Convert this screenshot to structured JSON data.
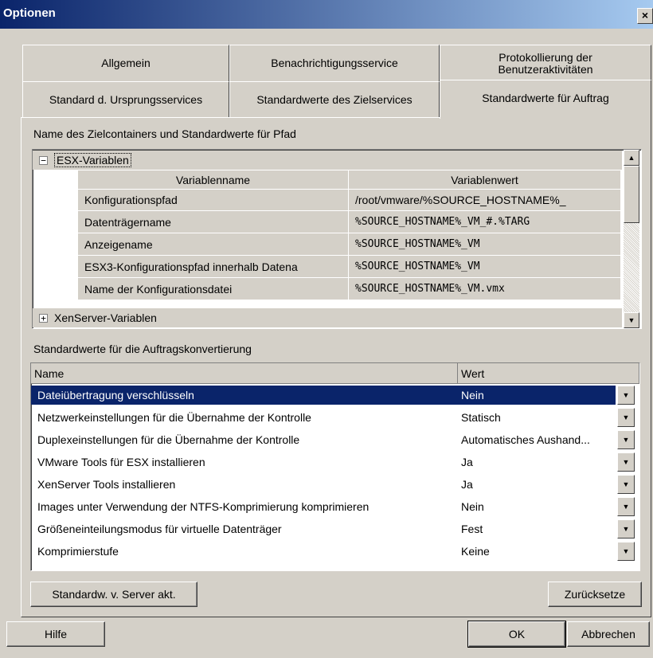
{
  "window": {
    "title": "Optionen",
    "close_symbol": "×"
  },
  "tabs_row1": [
    {
      "label": "Allgemein"
    },
    {
      "label": "Benachrichtigungsservice"
    },
    {
      "label": "Protokollierung der Benutzeraktivitäten"
    }
  ],
  "tabs_row2": [
    {
      "label": "Standard d. Ursprungsservices"
    },
    {
      "label": "Standardwerte des Zielservices"
    },
    {
      "label": "Standardwerte für Auftrag",
      "active": true
    }
  ],
  "container_section": {
    "label": "Name des Zielcontainers und Standardwerte für Pfad",
    "groups": [
      {
        "expander": "−",
        "label": "ESX-Variablen",
        "expanded": true
      },
      {
        "expander": "+",
        "label": "XenServer-Variablen",
        "expanded": false
      }
    ],
    "columns": [
      "Variablenname",
      "Variablenwert"
    ],
    "rows": [
      {
        "name": "Konfigurationspfad",
        "value": "/root/vmware/%SOURCE_HOSTNAME%_"
      },
      {
        "name": "Datenträgername",
        "value": "%SOURCE_HOSTNAME%_VM_#.%TARG"
      },
      {
        "name": "Anzeigename",
        "value": "%SOURCE_HOSTNAME%_VM"
      },
      {
        "name": "ESX3-Konfigurationspfad innerhalb Datena",
        "value": "%SOURCE_HOSTNAME%_VM"
      },
      {
        "name": "Name der Konfigurationsdatei",
        "value": "%SOURCE_HOSTNAME%_VM.vmx"
      }
    ]
  },
  "conversion_section": {
    "label": "Standardwerte für die Auftragskonvertierung",
    "columns": [
      "Name",
      "Wert"
    ],
    "rows": [
      {
        "name": "Dateiübertragung verschlüsseln",
        "value": "Nein",
        "selected": true
      },
      {
        "name": "Netzwerkeinstellungen für die Übernahme der Kontrolle",
        "value": "Statisch"
      },
      {
        "name": "Duplexeinstellungen für die Übernahme der Kontrolle",
        "value": "Automatisches Aushand..."
      },
      {
        "name": "VMware Tools für ESX installieren",
        "value": "Ja"
      },
      {
        "name": "XenServer Tools installieren",
        "value": "Ja"
      },
      {
        "name": "Images unter Verwendung der NTFS-Komprimierung komprimieren",
        "value": "Nein"
      },
      {
        "name": "Größeneinteilungsmodus für virtuelle Datenträger",
        "value": "Fest"
      },
      {
        "name": "Komprimierstufe",
        "value": "Keine"
      }
    ]
  },
  "buttons": {
    "refresh_defaults": "Standardw. v. Server akt.",
    "reset": "Zurücksetze",
    "help": "Hilfe",
    "ok": "OK",
    "cancel": "Abbrechen"
  }
}
